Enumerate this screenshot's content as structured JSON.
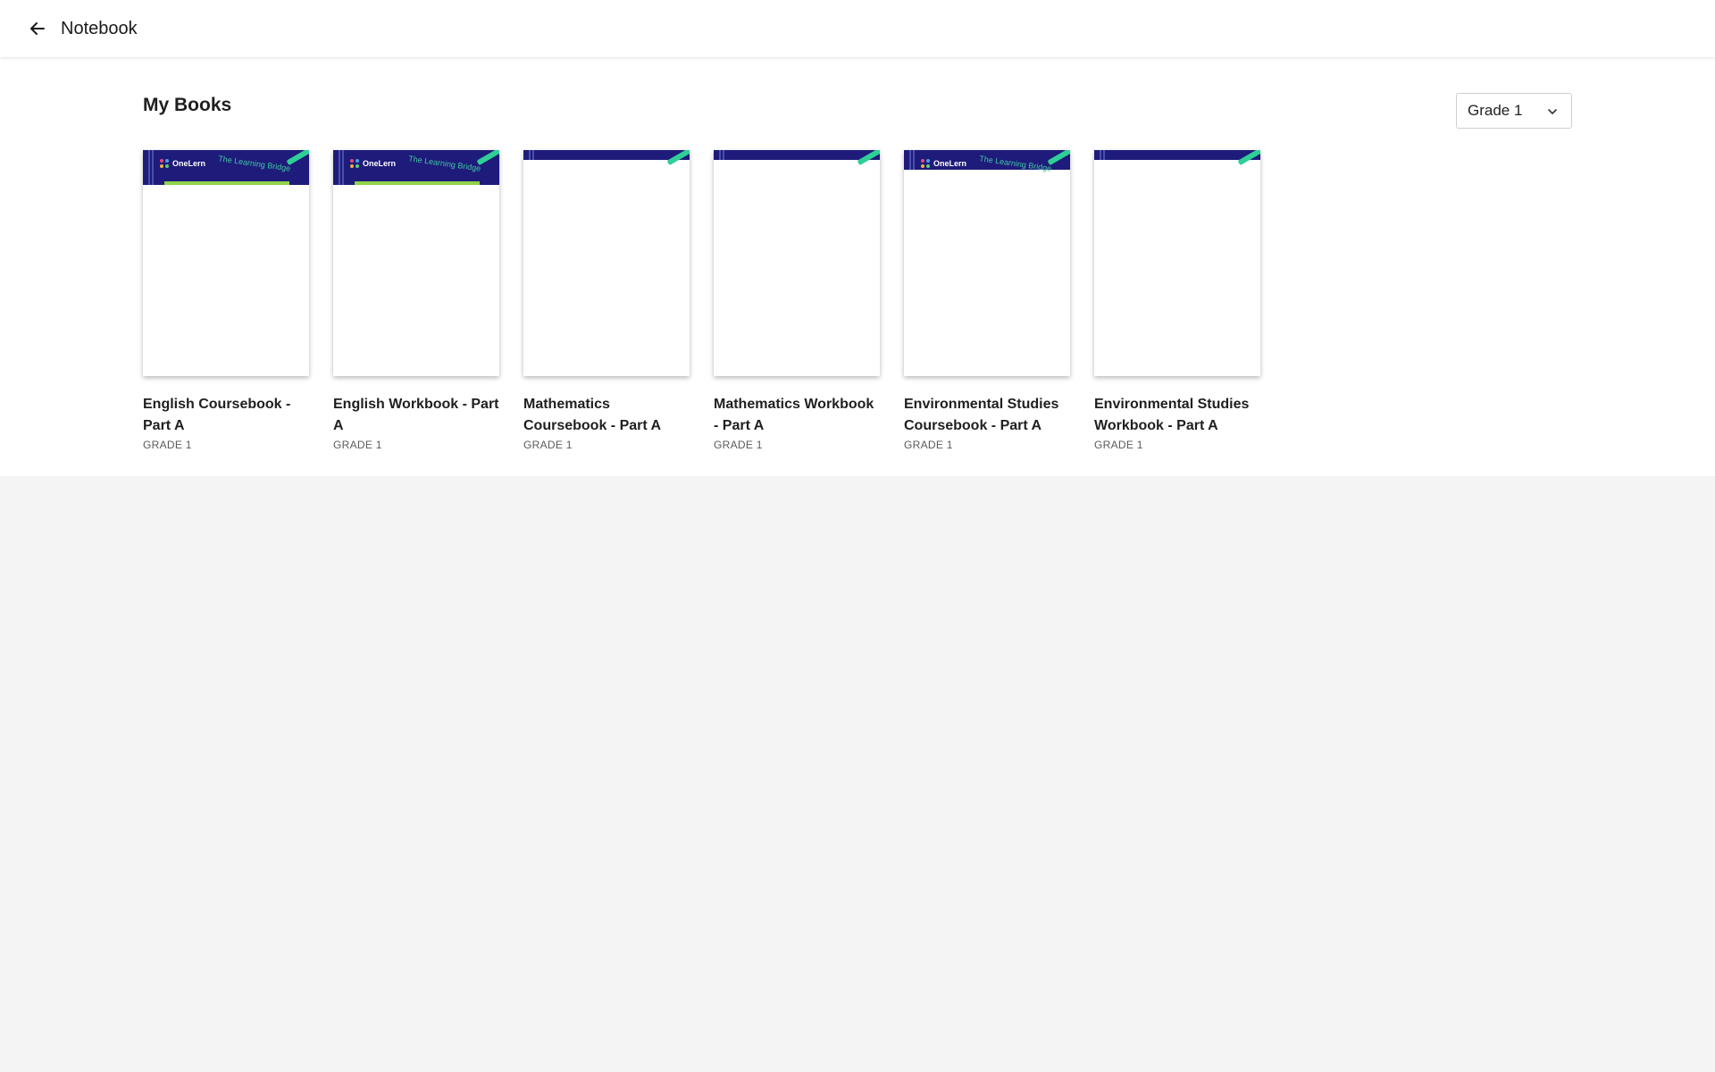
{
  "header": {
    "back_icon": "arrow-left-icon",
    "title": "Notebook"
  },
  "main": {
    "section_title": "My Books",
    "grade_filter": {
      "selected": "Grade 1",
      "icon": "chevron-down-icon"
    },
    "books": [
      {
        "title": "English Coursebook - Part A",
        "grade": "GRADE 1",
        "cover": {
          "brand": "OneLern",
          "tagline": "The Learning Bridge"
        }
      },
      {
        "title": "English Workbook - Part A",
        "grade": "GRADE 1",
        "cover": {
          "brand": "OneLern",
          "tagline": "The Learning Bridge"
        }
      },
      {
        "title": "Mathematics Coursebook - Part A",
        "grade": "GRADE 1",
        "cover": {
          "brand": "",
          "tagline": ""
        }
      },
      {
        "title": "Mathematics Workbook - Part A",
        "grade": "GRADE 1",
        "cover": {
          "brand": "",
          "tagline": ""
        }
      },
      {
        "title": "Environmental Studies Coursebook - Part A",
        "grade": "GRADE 1",
        "cover": {
          "brand": "OneLern",
          "tagline": "The Learning Bridge"
        }
      },
      {
        "title": "Environmental Studies Workbook - Part A",
        "grade": "GRADE 1",
        "cover": {
          "brand": "",
          "tagline": ""
        }
      }
    ]
  },
  "colors": {
    "cover_band": "#1e1b7a",
    "accent_green": "#2fcf96",
    "page_bg": "#f4f4f4"
  }
}
